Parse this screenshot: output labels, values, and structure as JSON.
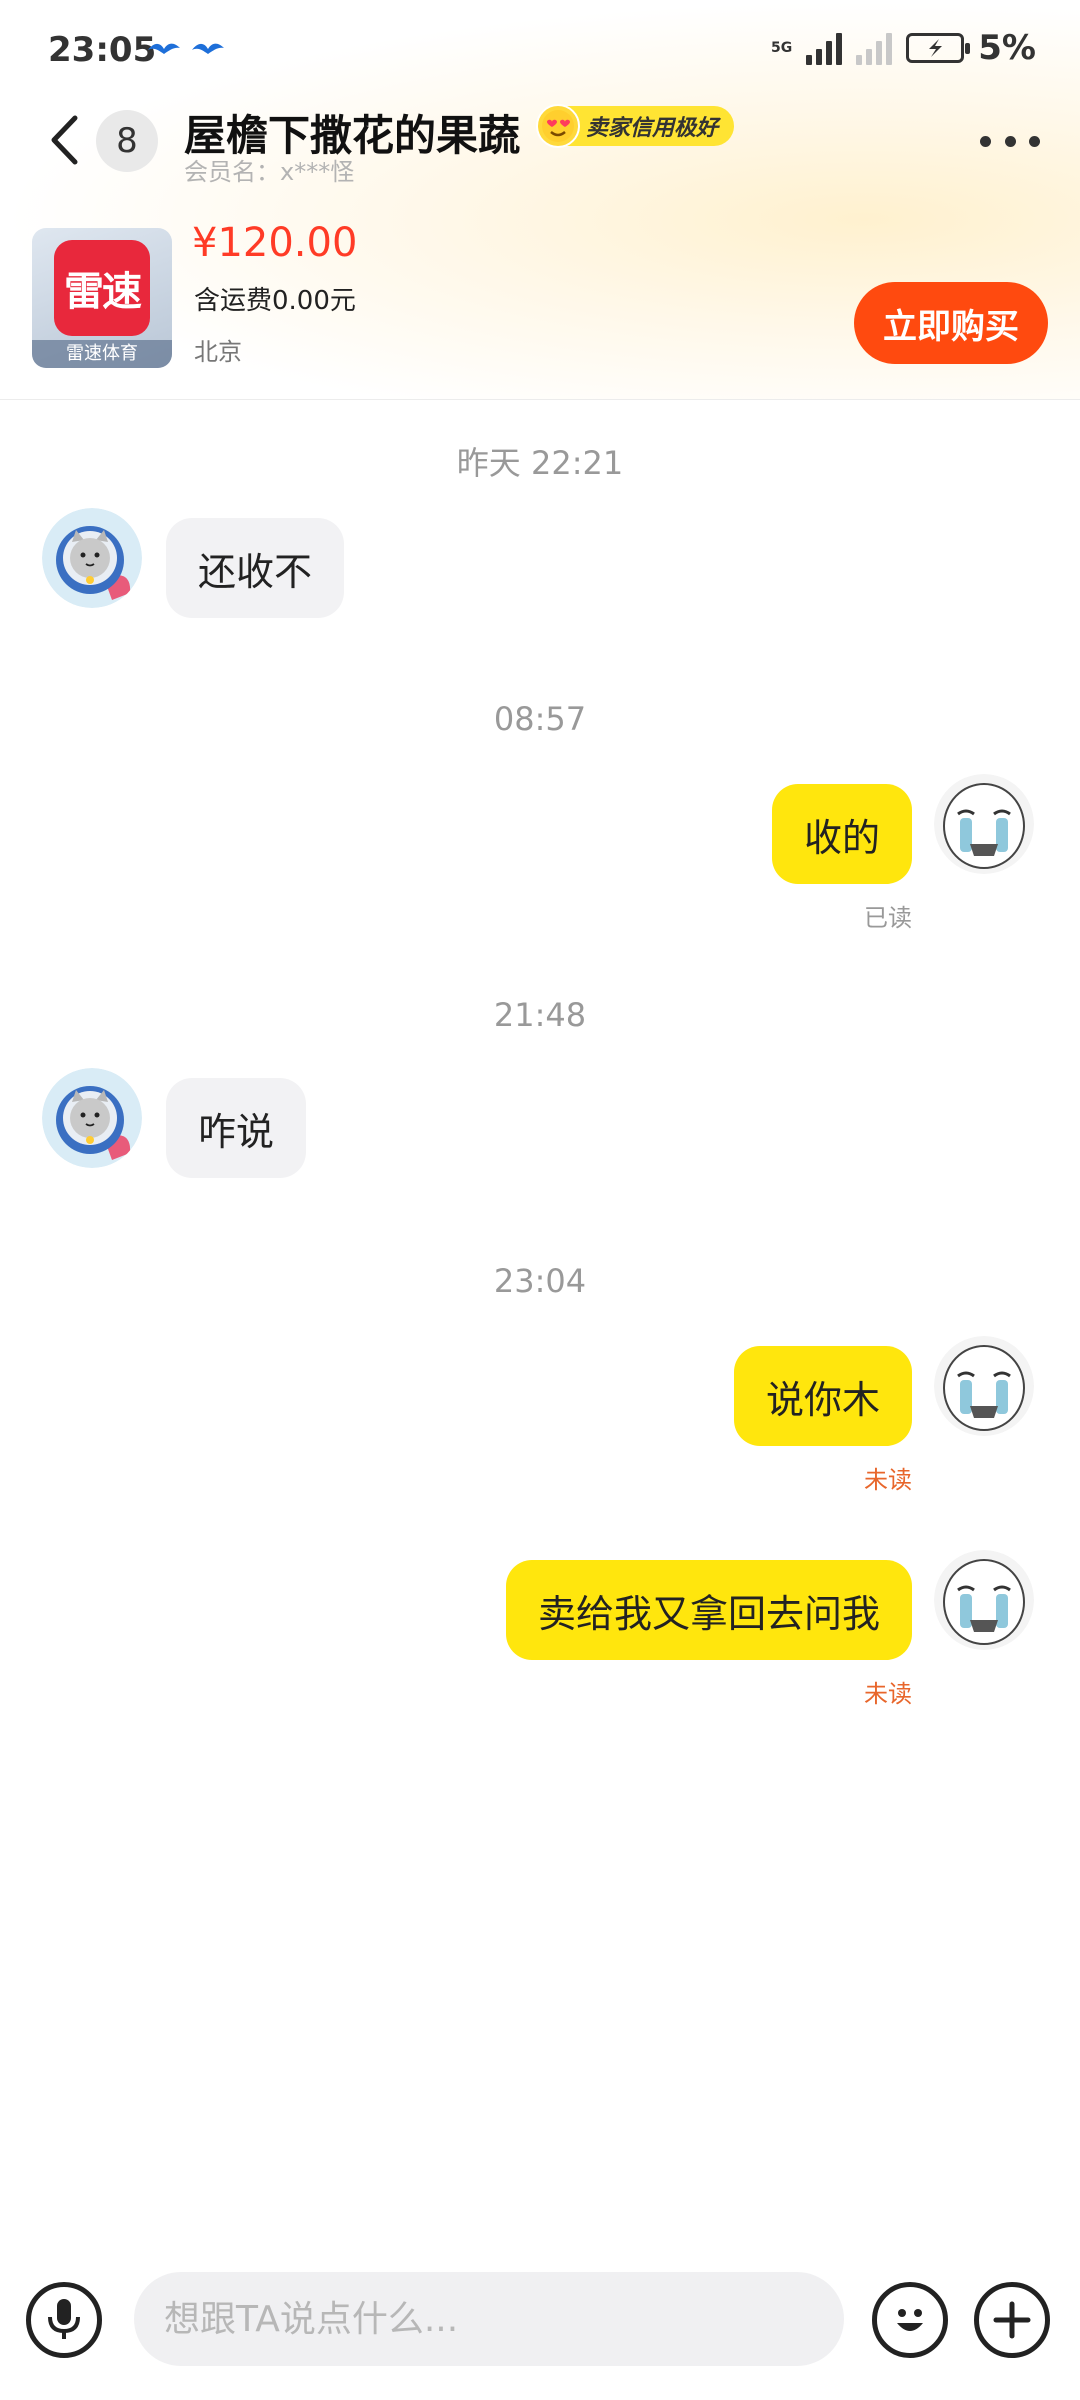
{
  "status_bar": {
    "time": "23:05",
    "network_label": "5G",
    "battery": "5%"
  },
  "header": {
    "unread_count": "8",
    "seller_name": "屋檐下撒花的果蔬",
    "credit_badge": "卖家信用极好",
    "member_label": "会员名：x***怪"
  },
  "product": {
    "image_logo_text": "雷速",
    "image_caption": "雷速体育",
    "price": "¥120.00",
    "shipping": "含运费0.00元",
    "location": "北京",
    "buy_label": "立即购买"
  },
  "chat": {
    "ts1": "昨天 22:21",
    "msg1": "还收不",
    "ts2": "08:57",
    "msg2": "收的",
    "msg2_status": "已读",
    "ts3": "21:48",
    "msg3": "咋说",
    "ts4": "23:04",
    "msg4": "说你木",
    "msg4_status": "未读",
    "msg5": "卖给我又拿回去问我",
    "msg5_status": "未读"
  },
  "input_bar": {
    "placeholder": "想跟TA说点什么..."
  },
  "colors": {
    "accent_orange": "#ff4a0f",
    "price_red": "#ff3b26",
    "bubble_yellow": "#ffe60d",
    "badge_yellow": "#ffe433"
  }
}
